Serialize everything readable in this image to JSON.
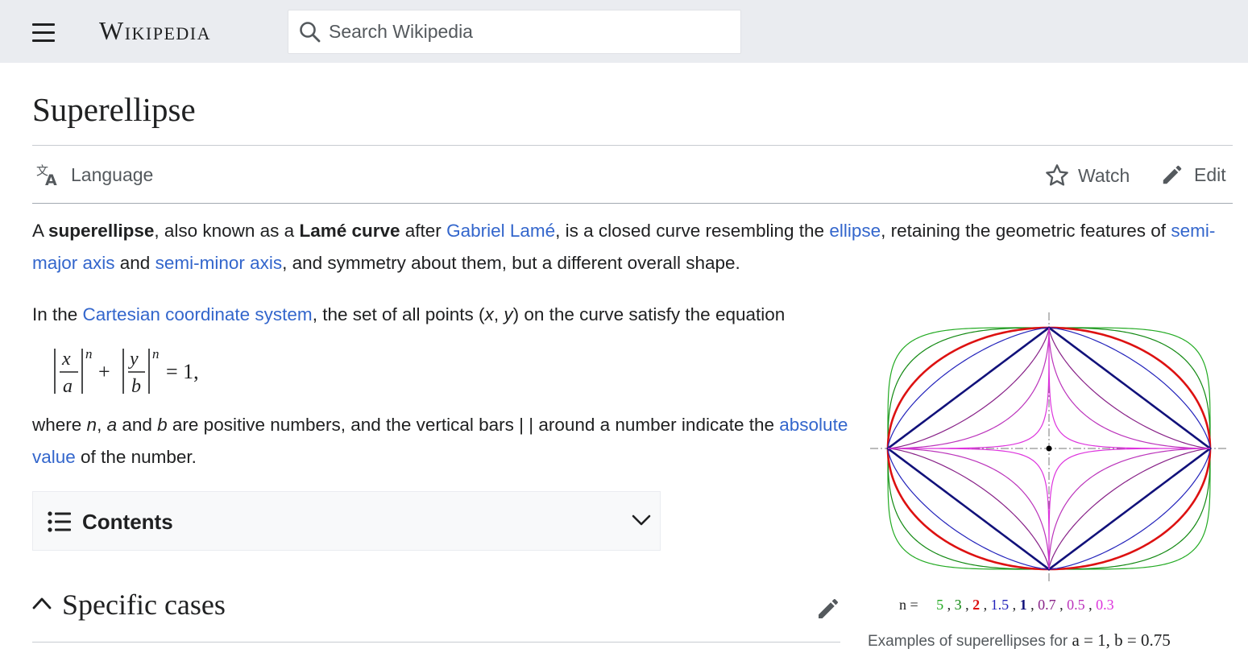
{
  "header": {
    "wordmark": "Wikipedia",
    "search": {
      "placeholder": "Search Wikipedia"
    }
  },
  "page": {
    "title": "Superellipse"
  },
  "toolbar": {
    "language": "Language",
    "watch": "Watch",
    "edit": "Edit"
  },
  "intro": {
    "p1": {
      "t1": "A ",
      "b1": "superellipse",
      "t2": ", also known as a ",
      "b2": "Lamé curve",
      "t3": " after ",
      "l1": "Gabriel Lamé",
      "t4": ", is a closed curve resembling the ",
      "l2": "ellipse",
      "t5": ", retaining the geometric features of ",
      "l3": "semi-major axis",
      "t6": " and ",
      "l4": "semi-minor axis",
      "t7": ", and symmetry about them, but a different overall shape."
    },
    "p2": {
      "t1": "In the ",
      "l1": "Cartesian coordinate system",
      "t2": ", the set of all points (",
      "i1": "x",
      "t3": ", ",
      "i2": "y",
      "t4": ") on the curve satisfy the equation"
    },
    "equation": {
      "x": "x",
      "a": "a",
      "y": "y",
      "b": "b",
      "n": "n",
      "plus": "+",
      "rhs": "= 1,"
    },
    "p3": {
      "t1": "where ",
      "i1": "n",
      "t2": ", ",
      "i2": "a",
      "t3": " and ",
      "i3": "b",
      "t4": " are positive numbers, and the vertical bars | | around a number indicate the ",
      "l1": "absolute value",
      "t5": " of the number."
    }
  },
  "contents": {
    "label": "Contents"
  },
  "section": {
    "title": "Specific cases"
  },
  "figure": {
    "legend": {
      "prefix": "n = ",
      "items": [
        {
          "value": "5",
          "color": "#22aa22"
        },
        {
          "value": "3",
          "color": "#118811"
        },
        {
          "value": "2",
          "color": "#dd1111"
        },
        {
          "value": "1.5",
          "color": "#2222bb"
        },
        {
          "value": "1",
          "color": "#11117a"
        },
        {
          "value": "0.7",
          "color": "#882288"
        },
        {
          "value": "0.5",
          "color": "#bb33bb"
        },
        {
          "value": "0.3",
          "color": "#dd33dd"
        }
      ]
    },
    "caption": {
      "text": "Examples of superellipses for ",
      "math": "a = 1,  b = 0.75"
    }
  },
  "colors": {
    "link": "#3366cc",
    "header_bg": "#eaecf0",
    "text": "#202122"
  }
}
